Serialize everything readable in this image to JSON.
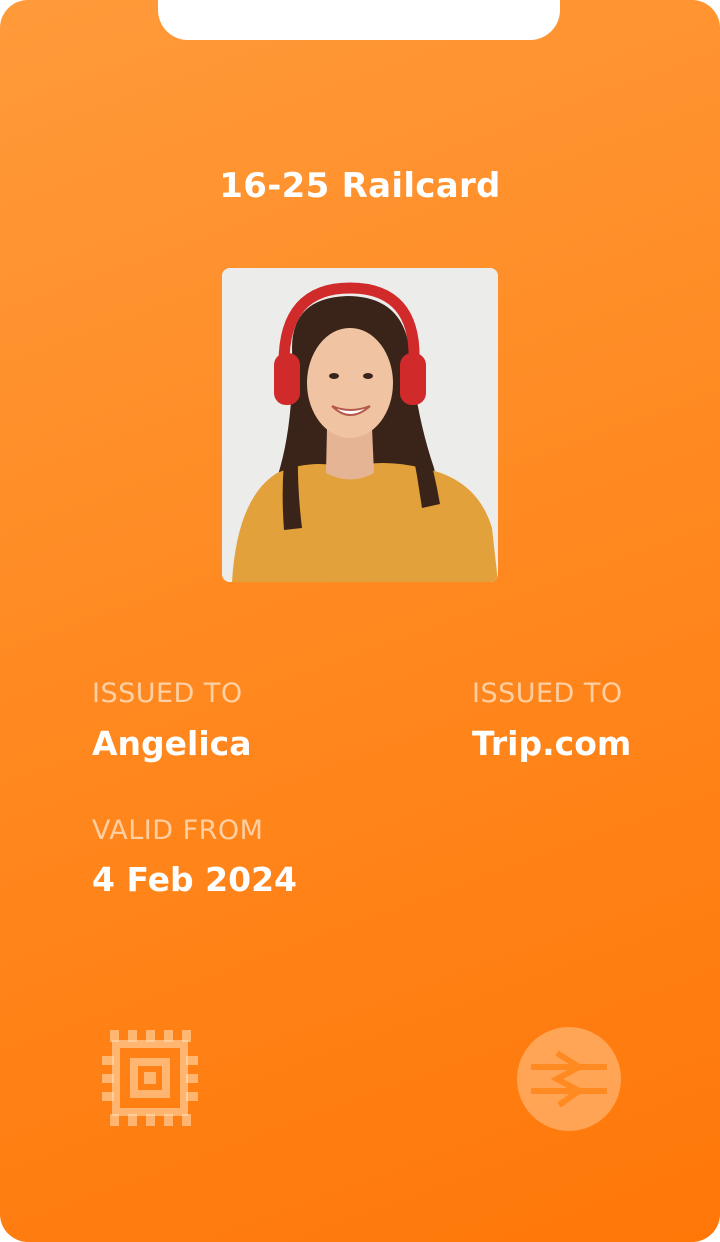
{
  "card": {
    "title": "16-25 Railcard",
    "accent_color": "#ff8a22",
    "photo": {
      "icon": "user-photo",
      "description": "cardholder-photo"
    },
    "fields": {
      "issued_to_left": {
        "label": "ISSUED TO",
        "value": "Angelica"
      },
      "issued_to_right": {
        "label": "ISSUED TO",
        "value": "Trip.com"
      },
      "valid_from": {
        "label": "VALID FROM",
        "value": "4 Feb 2024"
      }
    },
    "icons": {
      "chip": "chip-icon",
      "logo": "national-rail-logo-icon"
    }
  }
}
